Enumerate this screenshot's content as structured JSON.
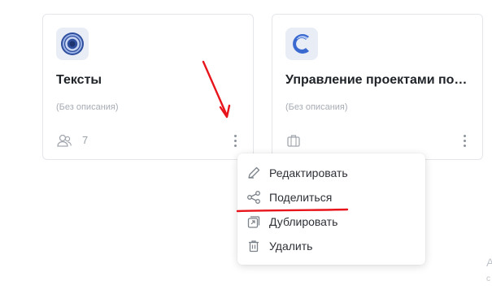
{
  "projects": [
    {
      "title": "Тексты",
      "description": "(Без описания)",
      "icon": "people-icon",
      "member_count": "7",
      "logo": "disc-logo",
      "brand_color": "#3a5aa8"
    },
    {
      "title": "Управление проектами по А...",
      "description": "(Без описания)",
      "icon": "briefcase-icon",
      "logo": "c-letter-logo",
      "brand_color": "#3a6ad0"
    }
  ],
  "context_menu": {
    "items": [
      {
        "label": "Редактировать",
        "icon": "pencil-icon"
      },
      {
        "label": "Поделиться",
        "icon": "share-icon"
      },
      {
        "label": "Дублировать",
        "icon": "duplicate-icon"
      },
      {
        "label": "Удалить",
        "icon": "trash-icon"
      }
    ]
  },
  "annotation": {
    "color": "#e8141b"
  },
  "edge_hint": {
    "line1": "А",
    "line2": "с"
  }
}
